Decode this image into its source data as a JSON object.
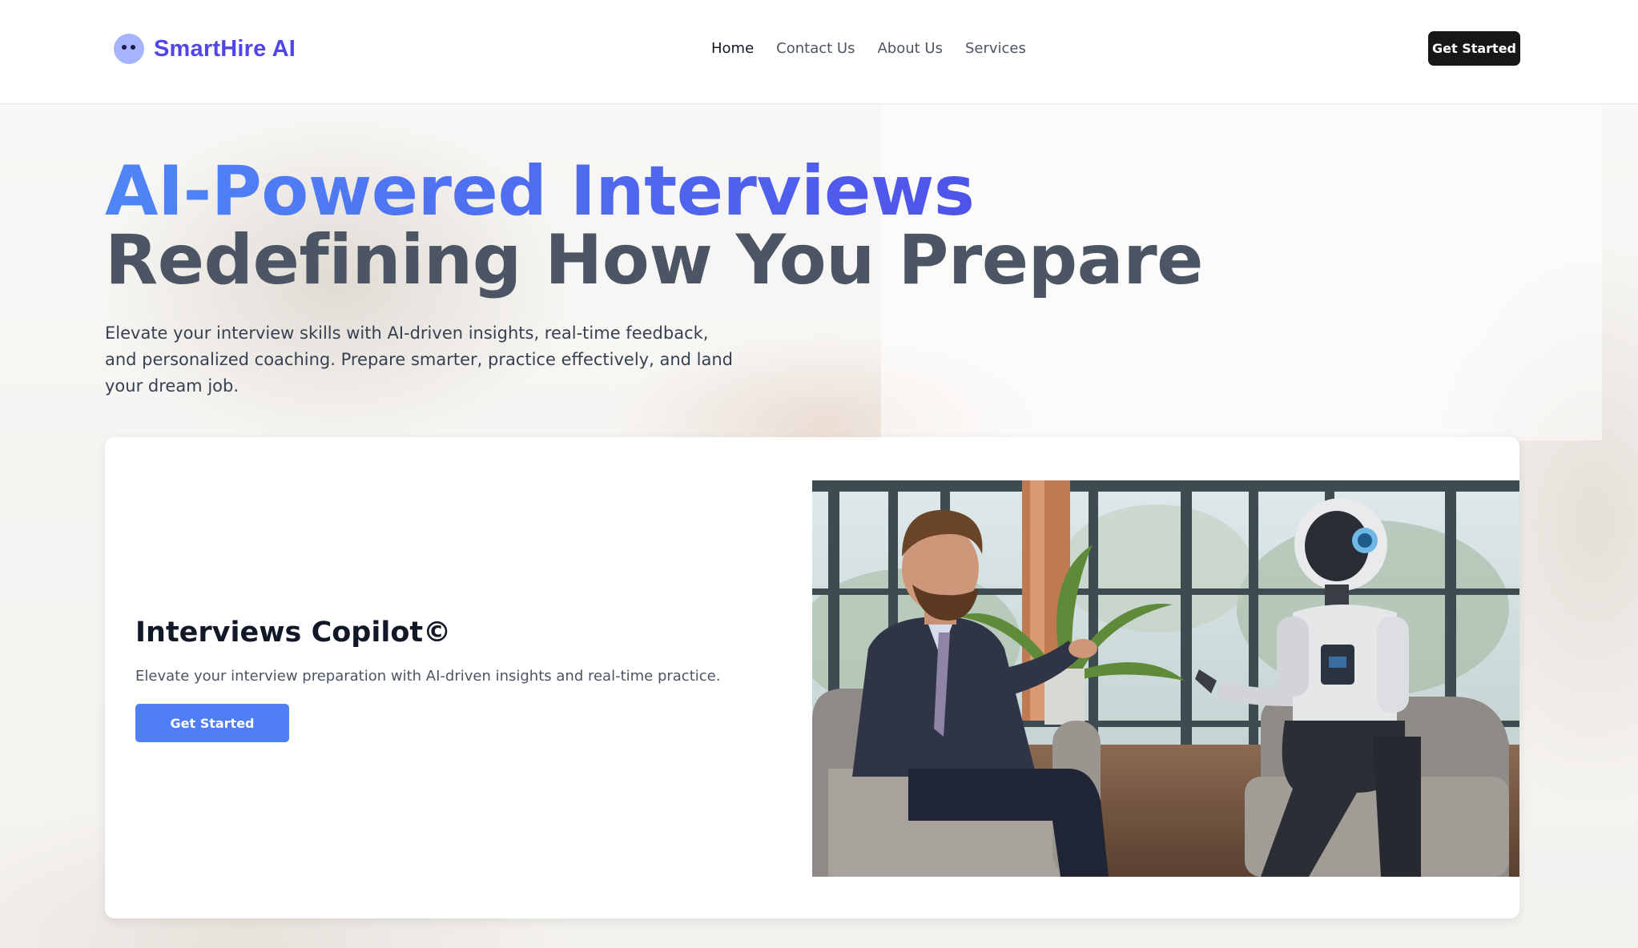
{
  "brand": {
    "name": "SmartHire AI",
    "logo_icon": "robot-face-icon",
    "accent": "#4f46e5"
  },
  "nav": {
    "items": [
      {
        "label": "Home",
        "active": true
      },
      {
        "label": "Contact Us",
        "active": false
      },
      {
        "label": "About Us",
        "active": false
      },
      {
        "label": "Services",
        "active": false
      }
    ],
    "cta_label": "Get Started"
  },
  "hero": {
    "headline_line1": "AI-Powered Interviews",
    "headline_line2": "Redefining How You Prepare",
    "description": "Elevate your interview skills with AI-driven insights, real-time feedback, and personalized coaching. Prepare smarter, practice effectively, and land your dream job.",
    "gradient": [
      "#4f86f7",
      "#4f46e5"
    ]
  },
  "feature": {
    "title": "Interviews Copilot©",
    "description": "Elevate your interview preparation with AI-driven insights and real-time practice.",
    "button_label": "Get Started",
    "button_color": "#4f7ef5"
  }
}
